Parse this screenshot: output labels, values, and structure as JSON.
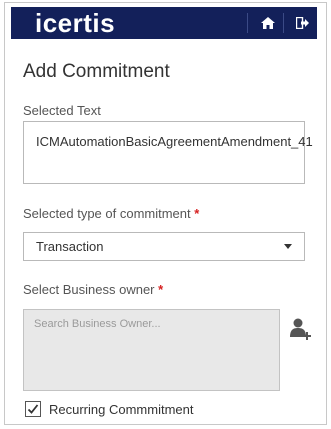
{
  "header": {
    "logo_text_main": "icertis",
    "home_icon": "home-icon",
    "logout_icon": "sign-out-icon"
  },
  "form": {
    "title": "Add Commitment",
    "selected_text_label": "Selected Text",
    "selected_text_value": "ICMAutomationBasicAgreementAmendment_41",
    "type_label": "Selected type of commitment",
    "type_required_mark": "*",
    "type_selected": "Transaction",
    "owner_label": "Select Business owner",
    "owner_required_mark": "*",
    "owner_placeholder": "Search Business Owner...",
    "add_owner_icon": "add-user-icon",
    "recurring_label": "Recurring Commmitment",
    "recurring_checked": true
  },
  "colors": {
    "header_bg": "#13205a",
    "required": "#d62020"
  }
}
